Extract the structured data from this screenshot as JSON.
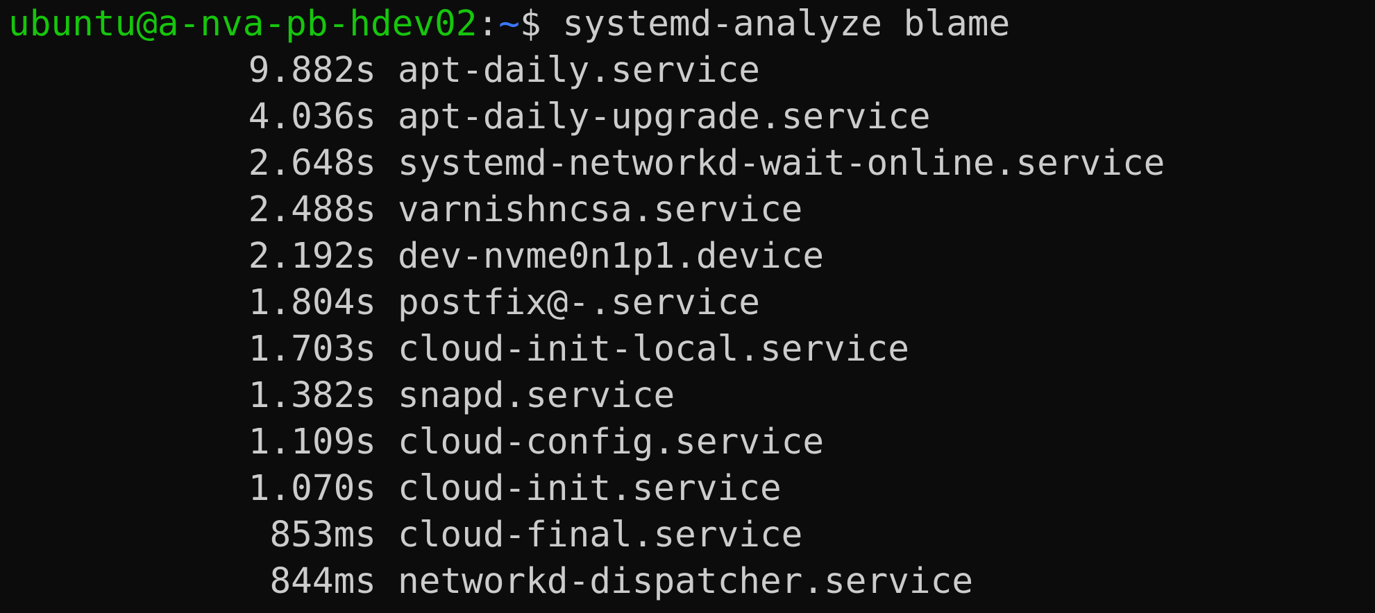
{
  "prompt": {
    "user_host": "ubuntu@a-nva-pb-hdev02",
    "colon": ":",
    "path": "~",
    "dollar": "$",
    "command": "systemd-analyze blame"
  },
  "rows": [
    {
      "time": "9.882s",
      "unit": "apt-daily.service"
    },
    {
      "time": "4.036s",
      "unit": "apt-daily-upgrade.service"
    },
    {
      "time": "2.648s",
      "unit": "systemd-networkd-wait-online.service"
    },
    {
      "time": "2.488s",
      "unit": "varnishncsa.service"
    },
    {
      "time": "2.192s",
      "unit": "dev-nvme0n1p1.device"
    },
    {
      "time": "1.804s",
      "unit": "postfix@-.service"
    },
    {
      "time": "1.703s",
      "unit": "cloud-init-local.service"
    },
    {
      "time": "1.382s",
      "unit": "snapd.service"
    },
    {
      "time": "1.109s",
      "unit": "cloud-config.service"
    },
    {
      "time": "1.070s",
      "unit": "cloud-init.service"
    },
    {
      "time": "853ms",
      "unit": "cloud-final.service"
    },
    {
      "time": "844ms",
      "unit": "networkd-dispatcher.service"
    }
  ],
  "colors": {
    "background": "#0c0c0c",
    "text": "#cccccc",
    "prompt_user": "#16c60c",
    "prompt_path": "#3b78ff"
  }
}
